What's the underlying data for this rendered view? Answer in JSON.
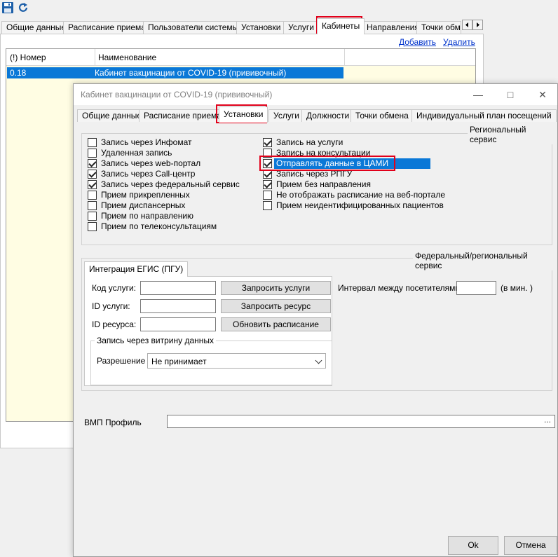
{
  "toolbar": {
    "save_icon": "save-icon",
    "refresh_icon": "refresh-icon"
  },
  "main_tabs": [
    "Общие данные",
    "Расписание приема",
    "Пользователи системы",
    "Установки",
    "Услуги",
    "Кабинеты",
    "Направления",
    "Точки обме"
  ],
  "main_actions": {
    "add": "Добавить",
    "delete": "Удалить"
  },
  "grid": {
    "columns": [
      "(!) Номер",
      "Наименование"
    ],
    "rows": [
      {
        "number": "0.18",
        "name": "Кабинет вакцинации от COVID-19 (прививочный)"
      }
    ]
  },
  "dialog": {
    "title": "Кабинет вакцинации от COVID-19 (прививочный)",
    "tabs": [
      "Общие данные",
      "Расписание приема",
      "Установки",
      "Услуги",
      "Должности",
      "Точки обмена",
      "Индивидуальный план посещений"
    ],
    "regional_group": "Региональный сервис",
    "left_checks": [
      {
        "label": "Запись через Инфомат",
        "checked": false
      },
      {
        "label": "Удаленная запись",
        "checked": false
      },
      {
        "label": "Запись через web-портал",
        "checked": true
      },
      {
        "label": "Запись через Call-центр",
        "checked": true
      },
      {
        "label": "Запись через федеральный сервис",
        "checked": true
      },
      {
        "label": "Прием прикрепленных",
        "checked": false
      },
      {
        "label": "Прием диспансерных",
        "checked": false
      },
      {
        "label": "Прием по направлению",
        "checked": false
      },
      {
        "label": "Прием по телеконсультациям",
        "checked": false
      }
    ],
    "right_checks": [
      {
        "label": "Запись на услуги",
        "checked": true
      },
      {
        "label": "Запись на консультации",
        "checked": false
      },
      {
        "label": "Отправлять данные в ЦАМИ",
        "checked": true
      },
      {
        "label": "Запись через РПГУ",
        "checked": true
      },
      {
        "label": "Прием без направления",
        "checked": true
      },
      {
        "label": "Не отображать расписание на веб-портале",
        "checked": false
      },
      {
        "label": "Прием неидентифицированных пациентов",
        "checked": false
      }
    ],
    "federal_group": "Федеральный/региональный сервис",
    "egis_tab": "Интеграция ЕГИС (ПГУ)",
    "service_code_label": "Код услуги:",
    "service_id_label": "ID услуги:",
    "resource_id_label": "ID ресурса:",
    "btn_request_services": "Запросить услуги",
    "btn_request_resource": "Запросить ресурс",
    "btn_update_schedule": "Обновить расписание",
    "interval_label": "Интервал между посетителями:",
    "interval_unit": "(в мин. )",
    "showcase_group": "Запись через витрину данных",
    "permission_label": "Разрешение",
    "permission_value": "Не принимает",
    "vmp_label": "ВМП Профиль",
    "vmp_button": "...",
    "ok": "Ok",
    "cancel": "Отмена"
  },
  "colors": {
    "selection": "#0a78d7",
    "highlight_frame": "#e1001a",
    "grid_background": "#fffde3"
  }
}
